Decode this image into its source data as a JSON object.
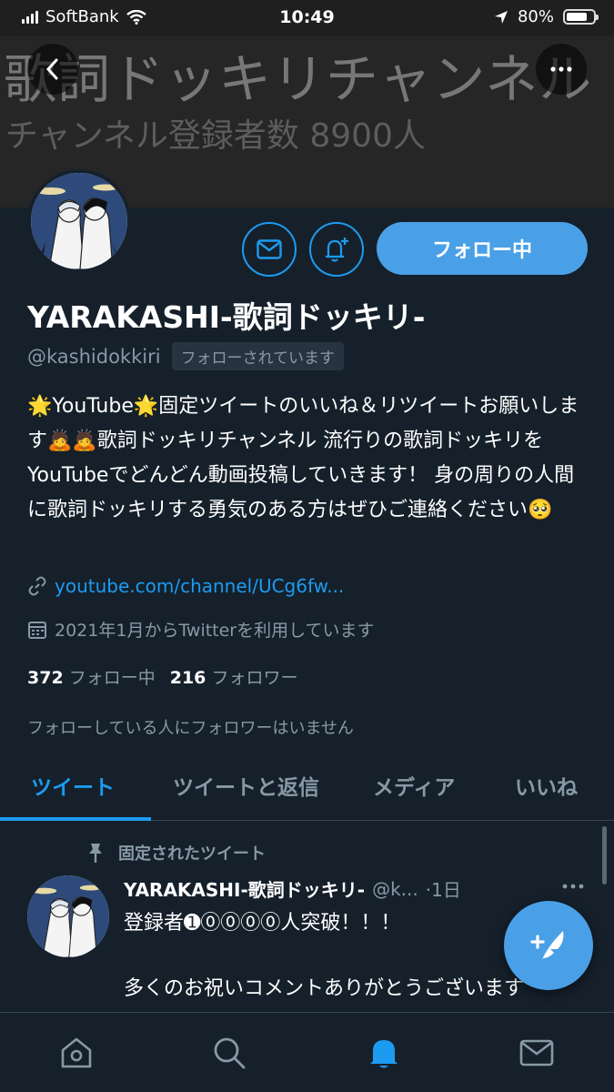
{
  "status_bar": {
    "carrier": "SoftBank",
    "time": "10:49",
    "battery": "80%",
    "battery_level": 0.8,
    "icons": [
      "signal-icon",
      "wifi-icon",
      "location-icon",
      "battery-icon"
    ]
  },
  "header": {
    "banner_title": "歌詞ドッキリチャンネル",
    "banner_subtitle": "チャンネル登録者数 8900人",
    "back_icon": "chevron-left-icon",
    "more_icon": "more-icon"
  },
  "profile": {
    "display_name": "YARAKASHI-歌詞ドッキリ-",
    "handle": "@kashidokkiri",
    "follows_you": "フォローされています",
    "follow_button": "フォロー中",
    "bio": "🌟YouTube🌟固定ツイートのいいね＆リツイートお願いします🙇🙇歌詞ドッキリチャンネル 流行りの歌詞ドッキリをYouTubeでどんどん動画投稿していきます！ 身の周りの人間に歌詞ドッキリする勇気のある方はぜひご連絡ください🥺",
    "link": "youtube.com/channel/UCg6fw...",
    "joined": "2021年1月からTwitterを利用しています",
    "following_count": "372",
    "following_label": "フォロー中",
    "followers_count": "216",
    "followers_label": "フォロワー",
    "known_followers": "フォローしている人にフォロワーはいません"
  },
  "tabs": [
    {
      "label": "ツイート",
      "active": true
    },
    {
      "label": "ツイートと返信",
      "active": false
    },
    {
      "label": "メディア",
      "active": false
    },
    {
      "label": "いいね",
      "active": false
    }
  ],
  "tweet": {
    "pinned_label": "固定されたツイート",
    "name": "YARAKASHI-歌詞ドッキリ-",
    "handle": "@k...",
    "time": "·1日",
    "line1": "登録者➊⓪⓪⓪⓪人突破！！！",
    "line2": "多くのお祝いコメントありがとうございます"
  },
  "bottom_nav": [
    "home-icon",
    "search-icon",
    "notifications-icon",
    "messages-icon"
  ],
  "colors": {
    "background": "#15202b",
    "accent": "#1d9bf0",
    "follow_button": "#4aa0e6",
    "secondary_text": "#8899a6"
  }
}
